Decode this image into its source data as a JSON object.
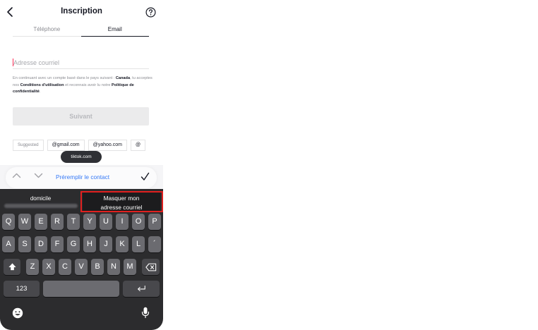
{
  "header": {
    "title": "Inscription",
    "back_icon": "chevron-left-icon",
    "help_icon": "help-circle-icon"
  },
  "tabs": [
    {
      "label": "Téléphone",
      "active": false
    },
    {
      "label": "Email",
      "active": true
    }
  ],
  "email_input": {
    "placeholder": "Adresse courriel",
    "value": ""
  },
  "legal": {
    "part1": "En continuant avec un compte basé dans le pays suivant :",
    "country": "Canada",
    "part2": ", tu acceptes nos",
    "terms": "Conditions d'utilisation",
    "part3": "et reconnais avoir lu notre",
    "privacy": "Politique de confidentialité",
    "part4": "."
  },
  "next_button": {
    "label": "Suivant"
  },
  "suggestions": {
    "label": "Suggested",
    "chips": [
      "@gmail.com",
      "@yahoo.com",
      "@"
    ]
  },
  "tooltip": {
    "text": "tiktok.com"
  },
  "autofill": {
    "prefill_label": "Préremplir le contact"
  },
  "keyboard": {
    "predictions": {
      "left": "domicile",
      "right_line1": "Masquer mon",
      "right_line2": "adresse courriel"
    },
    "row1": [
      "Q",
      "W",
      "E",
      "R",
      "T",
      "Y",
      "U",
      "I",
      "O",
      "P"
    ],
    "row2": [
      "A",
      "S",
      "D",
      "F",
      "G",
      "H",
      "J",
      "K",
      "L",
      "´"
    ],
    "row3": [
      "Z",
      "X",
      "C",
      "V",
      "B",
      "N",
      "M"
    ],
    "numbers_label": "123"
  },
  "colors": {
    "accent": "#fe2c55",
    "link_blue": "#3478f6",
    "highlight_red": "#e0201f",
    "keyboard_bg": "#2c2c2e"
  }
}
